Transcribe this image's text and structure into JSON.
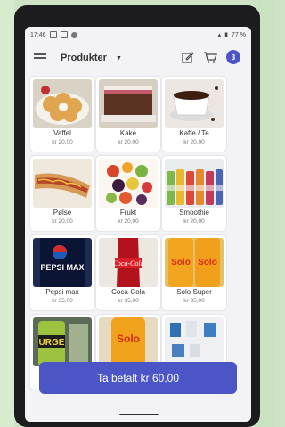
{
  "statusbar": {
    "time": "17:46",
    "signal_text": "ᯤ",
    "battery_percent": "77 %"
  },
  "header": {
    "title": "Produkter",
    "cart_count": "3"
  },
  "products": [
    {
      "name": "Vaffel",
      "price": "kr 20,00"
    },
    {
      "name": "Kake",
      "price": "kr 20,00"
    },
    {
      "name": "Kaffe / Te",
      "price": "kr 20,00"
    },
    {
      "name": "Pølse",
      "price": "kr 20,00"
    },
    {
      "name": "Frukt",
      "price": "kr 20,00"
    },
    {
      "name": "Smoothie",
      "price": "kr 20,00"
    },
    {
      "name": "Pepsi max",
      "price": "kr 35,00"
    },
    {
      "name": "Coca-Cola",
      "price": "kr 35,00"
    },
    {
      "name": "Solo Super",
      "price": "kr 35,00"
    }
  ],
  "product_image_text": {
    "pepsi": "PEPSI MAX",
    "coca": "Coca-Cola",
    "solo": "Solo",
    "urge": "URGE"
  },
  "pay_button": {
    "label": "Ta betalt kr 60,00"
  },
  "colors": {
    "accent": "#4b55c6",
    "background_green": "#cfe4c6"
  }
}
